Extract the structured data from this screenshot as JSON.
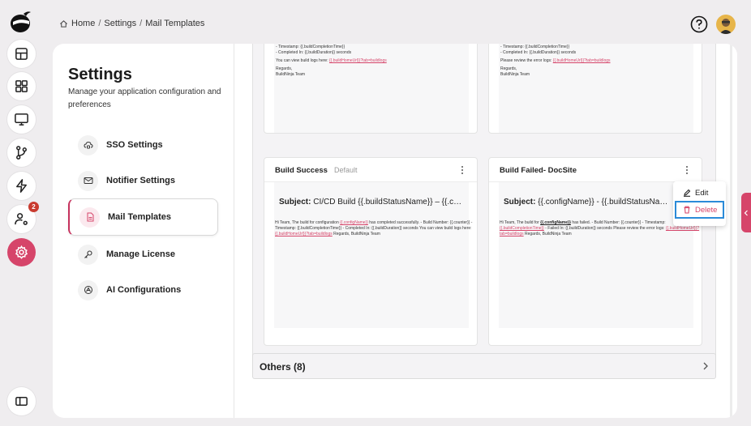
{
  "breadcrumb": {
    "home": "Home",
    "sep1": "/",
    "settings": "Settings",
    "sep2": "/",
    "current": "Mail Templates"
  },
  "rail": {
    "items": [
      "dashboard-icon",
      "apps-icon",
      "monitor-icon",
      "git-branch-icon",
      "lightning-icon",
      "user-settings-icon",
      "gear-icon"
    ],
    "notification_count": "2",
    "bottom": "sidebar-toggle-icon"
  },
  "settings": {
    "title": "Settings",
    "subtitle": "Manage your application configuration and preferences",
    "nav": [
      {
        "label": "SSO Settings",
        "icon": "cloud-lock-icon"
      },
      {
        "label": "Notifier Settings",
        "icon": "mail-icon"
      },
      {
        "label": "Mail Templates",
        "icon": "file-icon"
      },
      {
        "label": "Manage License",
        "icon": "key-icon"
      },
      {
        "label": "AI Configurations",
        "icon": "ai-icon"
      }
    ]
  },
  "top_cards": {
    "left": {
      "line1": "- Timestamp: {{.buildCompletionTime}}",
      "line2": "- Completed In: {{.buildDuration}} seconds",
      "line3_prefix": "You can view build logs here:",
      "line3_link": "{{.buildHomeUrl}}?tab=buildlogs",
      "regards": "Regards,",
      "team": "BuildNinja Team"
    },
    "right": {
      "line1": "- Timestamp: {{.buildCompletionTime}}",
      "line2": "- Completed In: {{.buildDuration}} seconds",
      "line3_prefix": "Please review the error logs:",
      "line3_link": "{{.buildHomeUrl}}?tab=buildlogs",
      "regards": "Regards,",
      "team": "BuildNinja Team"
    }
  },
  "cards": [
    {
      "title": "Build Success",
      "tag": "Default",
      "subject_label": "Subject:",
      "subject_value": "CI/CD Build {{.buildStatusName}} – {{.configName}}",
      "body_a": "Hi Team, The build for configuration",
      "body_link1": "{{.configName}}",
      "body_b": "has completed successfully. - Build Number: {{.counter}} - Timestamp: {{.buildCompletionTime}} - Completed In: {{.buildDuration}} seconds You can view build logs here:",
      "body_link2": "{{.buildHomeUrl}}?tab=buildlogs",
      "body_c": "Regards, BuildNinja Team"
    },
    {
      "title": "Build Failed- DocSite",
      "tag": "",
      "subject_label": "Subject:",
      "subject_value": "{{.configName}} - {{.buildStatusName(str",
      "body_a": "Hi Team, The build for",
      "body_link1": "{{.configName}}",
      "body_b": "has failed. - Build Number: {{.counter}} - Timestamp:",
      "body_link2": "{{.buildCompletionTime}}",
      "body_c": "- Failed In: {{.buildDuration}} seconds Please review the error logs:",
      "body_link3": "{{.buildHomeUrl}}?tab=buildlogs",
      "body_d": "Regards, BuildNinja Team"
    }
  ],
  "others": {
    "label": "Others (8)"
  },
  "menu": {
    "edit": "Edit",
    "delete": "Delete"
  },
  "colors": {
    "accent": "#d6456a",
    "focus": "#2b8bd8",
    "badge": "#c93b2f"
  }
}
